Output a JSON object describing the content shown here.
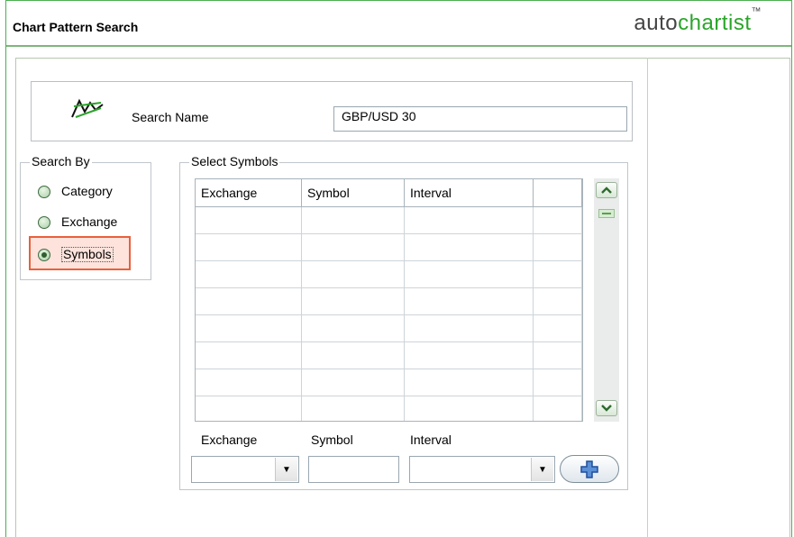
{
  "window": {
    "title": "Chart Pattern Search",
    "brand": {
      "part1": "auto",
      "part2": "chartist",
      "trademark": "™"
    }
  },
  "search": {
    "label": "Search Name",
    "value": "GBP/USD 30",
    "icon": "chart-pattern-icon"
  },
  "search_by": {
    "legend": "Search By",
    "options": [
      {
        "label": "Category",
        "selected": false
      },
      {
        "label": "Exchange",
        "selected": false
      },
      {
        "label": "Symbols",
        "selected": true
      }
    ]
  },
  "select_symbols": {
    "legend": "Select Symbols",
    "columns": [
      "Exchange",
      "Symbol",
      "Interval",
      ""
    ],
    "rows": [
      [
        "",
        "",
        "",
        ""
      ],
      [
        "",
        "",
        "",
        ""
      ],
      [
        "",
        "",
        "",
        ""
      ],
      [
        "",
        "",
        "",
        ""
      ],
      [
        "",
        "",
        "",
        ""
      ],
      [
        "",
        "",
        "",
        ""
      ],
      [
        "",
        "",
        "",
        ""
      ],
      [
        "",
        "",
        "",
        ""
      ]
    ],
    "fields": {
      "exchange_label": "Exchange",
      "symbol_label": "Symbol",
      "interval_label": "Interval",
      "exchange_value": "",
      "symbol_value": "",
      "interval_value": ""
    },
    "add_icon": "plus-icon"
  },
  "colors": {
    "accent_green": "#2aa52a",
    "highlight_border": "#e8603c",
    "highlight_fill": "#fde3dc"
  }
}
